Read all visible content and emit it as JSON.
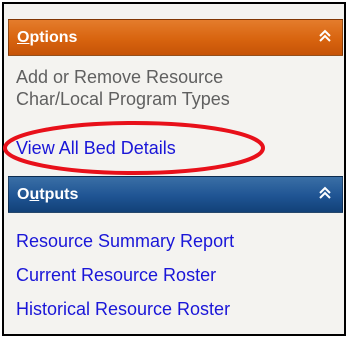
{
  "options": {
    "title_first": "O",
    "title_rest": "ptions",
    "collapse_glyph": "⌃⌃",
    "items": [
      {
        "line1": "Add or Remove Resource",
        "line2": "Char/Local Program Types"
      },
      {
        "label": "View All Bed Details"
      }
    ]
  },
  "outputs": {
    "title_first": "O",
    "title_u": "u",
    "title_rest": "tputs",
    "collapse_glyph": "⌃⌃",
    "items": [
      {
        "label": "Resource Summary Report"
      },
      {
        "label": "Current Resource Roster"
      },
      {
        "label": "Historical Resource Roster"
      }
    ]
  },
  "colors": {
    "options_header": "#d8640f",
    "outputs_header": "#1f5493",
    "link": "#1a16d8",
    "annotation": "#e8101a"
  }
}
